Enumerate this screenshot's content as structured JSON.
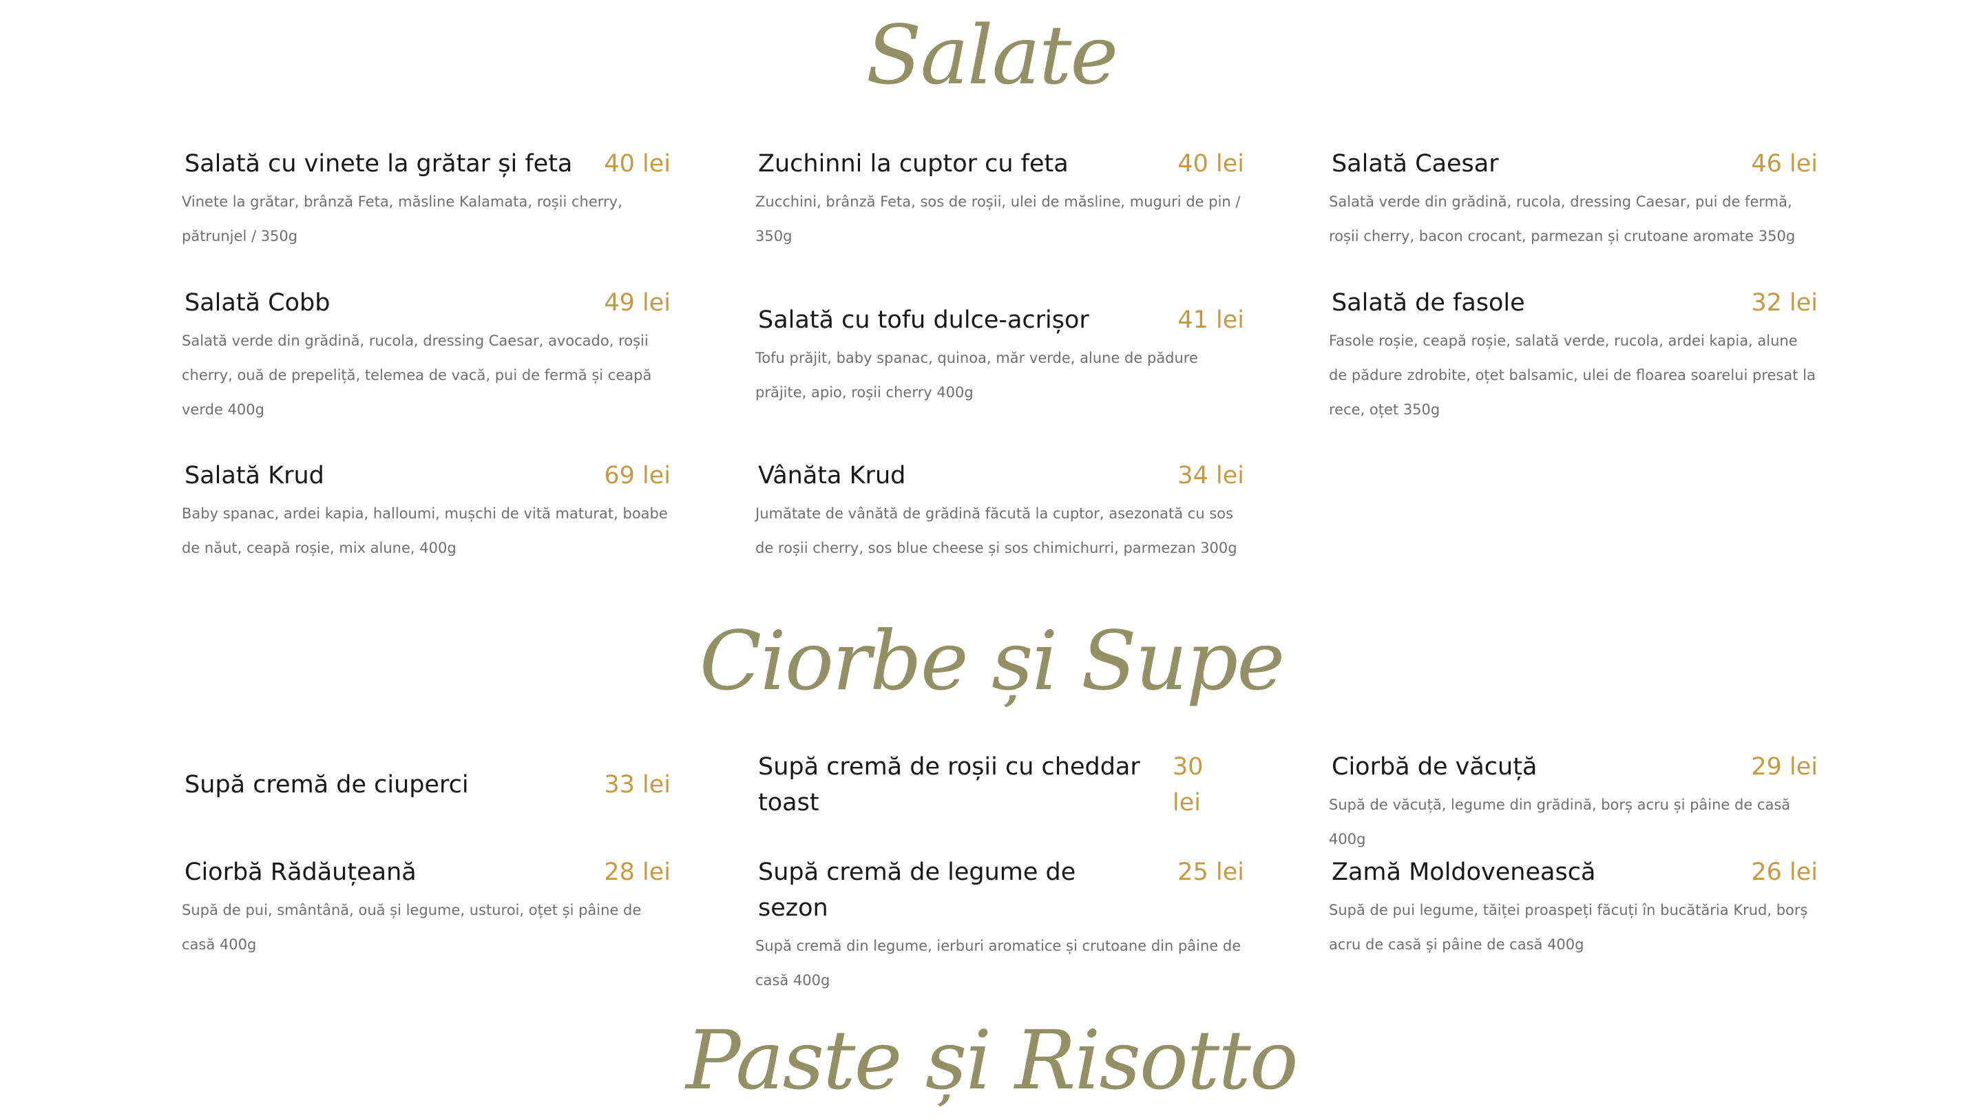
{
  "sections": {
    "salate": {
      "title": "Salate",
      "items": [
        {
          "name": "Salată cu vinete la grătar și feta",
          "price": "40 lei",
          "desc": "Vinete la grătar, brânză Feta, măsline Kalamata, roșii cherry, pătrunjel / 350g"
        },
        {
          "name": "Zuchinni la cuptor cu feta",
          "price": "40 lei",
          "desc": "Zucchini, brânză Feta, sos de roșii, ulei de măsline, muguri de pin / 350g"
        },
        {
          "name": "Salată Caesar",
          "price": "46 lei",
          "desc": "Salată verde din grădină, rucola, dressing Caesar, pui de fermă, roșii cherry, bacon crocant, parmezan și crutoane aromate 350g"
        },
        {
          "name": "Salată Cobb",
          "price": "49 lei",
          "desc": "Salată verde din grădină, rucola, dressing Caesar, avocado, roșii cherry, ouă de prepeliță, telemea de vacă, pui de fermă și ceapă verde 400g"
        },
        {
          "name": "Salată cu tofu dulce-acrișor",
          "price": "41 lei",
          "desc": "Tofu prăjit, baby spanac, quinoa, măr verde, alune de pădure prăjite, apio, roșii cherry 400g"
        },
        {
          "name": "Salată de fasole",
          "price": "32 lei",
          "desc": "Fasole roșie, ceapă roșie, salată verde, rucola, ardei kapia, alune de pădure zdrobite, oțet balsamic, ulei de floarea soarelui presat la rece, oțet 350g"
        },
        {
          "name": "Salată Krud",
          "price": "69 lei",
          "desc": "Baby spanac, ardei kapia, halloumi, mușchi de vită maturat, boabe de năut, ceapă roșie, mix alune, 400g"
        },
        {
          "name": "Vânăta Krud",
          "price": "34 lei",
          "desc": "Jumătate de vânătă de grădină făcută la cuptor, asezonată cu sos de roșii cherry, sos blue cheese și sos chimichurri, parmezan 300g"
        }
      ]
    },
    "ciorbe": {
      "title": "Ciorbe și Supe",
      "items": [
        {
          "name": "Supă cremă de ciuperci",
          "price": "33 lei",
          "desc": ""
        },
        {
          "name": "Supă cremă de roșii cu cheddar toast",
          "price": "30 lei",
          "desc": ""
        },
        {
          "name": "Ciorbă de văcuță",
          "price": "29 lei",
          "desc": "Supă de văcuță, legume din grădină, borș acru și pâine de casă 400g"
        },
        {
          "name": "Ciorbă Rădăuțeană",
          "price": "28 lei",
          "desc": "Supă de pui, smântână, ouă și legume, usturoi, oțet și pâine de casă 400g"
        },
        {
          "name": "Supă cremă de legume de sezon",
          "price": "25 lei",
          "desc": "Supă cremă din legume, ierburi aromatice și crutoane din pâine de casă 400g"
        },
        {
          "name": "Zamă Moldovenească",
          "price": "26 lei",
          "desc": "Supă de pui legume, tăiței proaspeți făcuți în bucătăria Krud, borș acru de casă și pâine de casă 400g"
        }
      ]
    },
    "paste": {
      "title": "Paste și Risotto"
    }
  },
  "colors": {
    "title": "#939065",
    "price": "#c49a45",
    "name": "#171717",
    "desc": "#6f6f6f"
  }
}
